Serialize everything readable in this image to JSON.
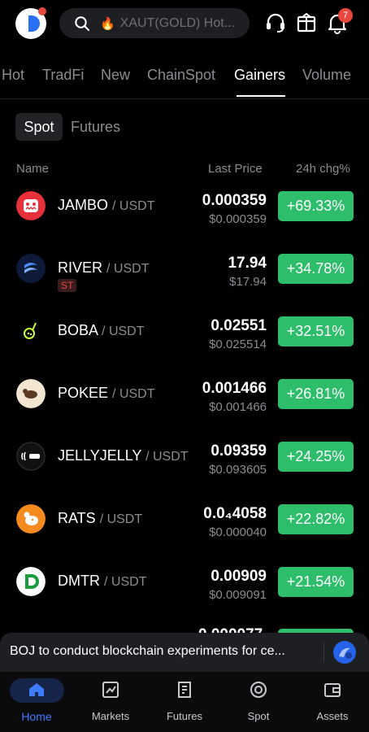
{
  "header": {
    "search_placeholder": "XAUT(GOLD) Hot...",
    "notification_count": "7",
    "icons": [
      "app-logo",
      "search-icon",
      "fire-icon",
      "headset-icon",
      "gift-box-icon",
      "bell-icon"
    ]
  },
  "tabs": [
    {
      "label": "Hot",
      "active": false
    },
    {
      "label": "TradFi",
      "active": false
    },
    {
      "label": "New",
      "active": false
    },
    {
      "label": "ChainSpot",
      "active": false
    },
    {
      "label": "Gainers",
      "active": true
    },
    {
      "label": "Volume",
      "active": false
    }
  ],
  "subtabs": [
    {
      "label": "Spot",
      "active": true
    },
    {
      "label": "Futures",
      "active": false
    }
  ],
  "columns": {
    "name": "Name",
    "last_price": "Last Price",
    "change": "24h chg%"
  },
  "rows": [
    {
      "base": "JAMBO",
      "quote": "/ USDT",
      "tag": "",
      "price": "0.000359",
      "fiat": "$0.000359",
      "change": "+69.33%"
    },
    {
      "base": "RIVER",
      "quote": "/ USDT",
      "tag": "ST",
      "price": "17.94",
      "fiat": "$17.94",
      "change": "+34.78%"
    },
    {
      "base": "BOBA",
      "quote": "/ USDT",
      "tag": "",
      "price": "0.02551",
      "fiat": "$0.025514",
      "change": "+32.51%"
    },
    {
      "base": "POKEE",
      "quote": "/ USDT",
      "tag": "",
      "price": "0.001466",
      "fiat": "$0.001466",
      "change": "+26.81%"
    },
    {
      "base": "JELLYJELLY",
      "quote": "/ USDT",
      "tag": "",
      "price": "0.09359",
      "fiat": "$0.093605",
      "change": "+24.25%"
    },
    {
      "base": "RATS",
      "quote": "/ USDT",
      "tag": "",
      "price": "0.0₄4058",
      "fiat": "$0.000040",
      "change": "+22.82%"
    },
    {
      "base": "DMTR",
      "quote": "/ USDT",
      "tag": "",
      "price": "0.00909",
      "fiat": "$0.009091",
      "change": "+21.54%"
    }
  ],
  "partial_row_price": "0.000077",
  "news": {
    "text": "BOJ to conduct blockchain experiments for ce..."
  },
  "nav": [
    {
      "label": "Home",
      "active": true
    },
    {
      "label": "Markets",
      "active": false
    },
    {
      "label": "Futures",
      "active": false
    },
    {
      "label": "Spot",
      "active": false
    },
    {
      "label": "Assets",
      "active": false
    }
  ],
  "colors": {
    "accent": "#3d7bff",
    "gain": "#2ebd6b",
    "danger": "#e8473e",
    "background": "#000000",
    "muted": "#8a8c92"
  }
}
